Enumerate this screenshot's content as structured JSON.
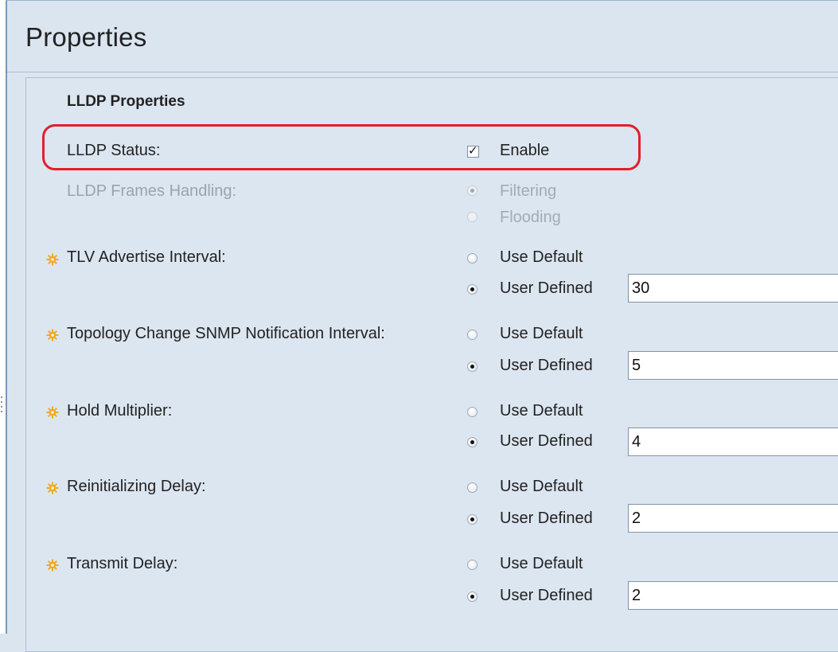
{
  "page": {
    "title": "Properties"
  },
  "section": {
    "title": "LLDP Properties"
  },
  "lldp_status": {
    "label": "LLDP Status:",
    "checkbox_label": "Enable",
    "checked": true
  },
  "frames_handling": {
    "label": "LLDP Frames Handling:",
    "disabled": true,
    "options": [
      "Filtering",
      "Flooding"
    ],
    "selected": "Filtering"
  },
  "fields": [
    {
      "label": "TLV Advertise Interval:",
      "use_default": "Use Default",
      "user_defined": "User Defined",
      "selected": "User Defined",
      "value": "30"
    },
    {
      "label": "Topology Change SNMP Notification Interval:",
      "use_default": "Use Default",
      "user_defined": "User Defined",
      "selected": "User Defined",
      "value": "5"
    },
    {
      "label": "Hold Multiplier:",
      "use_default": "Use Default",
      "user_defined": "User Defined",
      "selected": "User Defined",
      "value": "4"
    },
    {
      "label": "Reinitializing Delay:",
      "use_default": "Use Default",
      "user_defined": "User Defined",
      "selected": "User Defined",
      "value": "2"
    },
    {
      "label": "Transmit Delay:",
      "use_default": "Use Default",
      "user_defined": "User Defined",
      "selected": "User Defined",
      "value": "2"
    }
  ],
  "icons": {
    "required_field": "gear-icon"
  },
  "colors": {
    "highlight": "#e31e2a",
    "gear": "#f5a623",
    "background": "#dce6f1"
  }
}
